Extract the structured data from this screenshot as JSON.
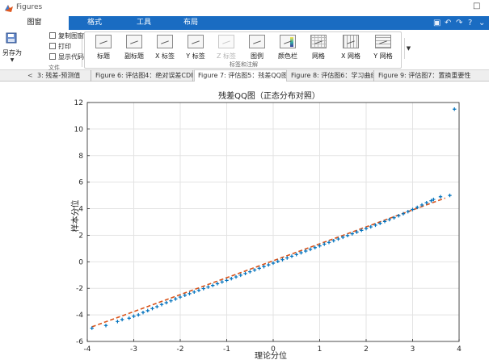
{
  "window": {
    "title": "Figures"
  },
  "ribbon": {
    "tabs": [
      {
        "label": "图窗",
        "active": true
      },
      {
        "label": "格式",
        "active": false
      },
      {
        "label": "工具",
        "active": false
      },
      {
        "label": "布局",
        "active": false
      }
    ]
  },
  "toolstrip": {
    "file_group": {
      "save_as": "另存为",
      "copy_figure": "复制图窗",
      "print": "打印",
      "show_code": "显示代码",
      "label": "文件"
    },
    "annotation_group": {
      "label": "标签和注解",
      "buttons": [
        {
          "label": "标题",
          "enabled": true
        },
        {
          "label": "副标题",
          "enabled": true
        },
        {
          "label": "X 标签",
          "enabled": true
        },
        {
          "label": "Y 标签",
          "enabled": true
        },
        {
          "label": "Z 标签",
          "enabled": false
        },
        {
          "label": "图例",
          "enabled": true
        },
        {
          "label": "颜色栏",
          "enabled": true
        },
        {
          "label": "网格",
          "enabled": true
        },
        {
          "label": "X 网格",
          "enabled": true
        },
        {
          "label": "Y 网格",
          "enabled": true
        }
      ]
    }
  },
  "figure_tabs": {
    "tabs": [
      {
        "label": "3: 残差-预测值",
        "active": false
      },
      {
        "label": "Figure 6: 评估图4：绝对误差CDF",
        "active": false
      },
      {
        "label": "Figure 7: 评估图5：残差QQ图",
        "active": true
      },
      {
        "label": "Figure 8: 评估图6：学习曲线",
        "active": false
      },
      {
        "label": "Figure 9: 评估图7：置换重要性",
        "active": false
      }
    ]
  },
  "chart_data": {
    "type": "scatter",
    "title": "残差QQ图（正态分布对照）",
    "xlabel": "理论分位",
    "ylabel": "样本分位",
    "xlim": [
      -4,
      4
    ],
    "ylim": [
      -6,
      12
    ],
    "xticks": [
      -4,
      -3,
      -2,
      -1,
      0,
      1,
      2,
      3,
      4
    ],
    "yticks": [
      -6,
      -4,
      -2,
      0,
      2,
      4,
      6,
      8,
      10,
      12
    ],
    "grid": true,
    "box": true,
    "series": [
      {
        "kind": "scatter",
        "marker": "+",
        "color": "#0072bd",
        "points": [
          [
            -3.9,
            -5.0
          ],
          [
            -3.6,
            -4.8
          ],
          [
            -3.35,
            -4.5
          ],
          [
            -3.25,
            -4.35
          ],
          [
            -3.1,
            -4.25
          ],
          [
            -3.0,
            -4.1
          ],
          [
            -2.9,
            -4.0
          ],
          [
            -2.8,
            -3.82
          ],
          [
            -2.7,
            -3.68
          ],
          [
            -2.6,
            -3.52
          ],
          [
            -2.5,
            -3.38
          ],
          [
            -2.4,
            -3.22
          ],
          [
            -2.3,
            -3.08
          ],
          [
            -2.2,
            -2.94
          ],
          [
            -2.1,
            -2.8
          ],
          [
            -2.0,
            -2.66
          ],
          [
            -1.9,
            -2.52
          ],
          [
            -1.8,
            -2.4
          ],
          [
            -1.7,
            -2.28
          ],
          [
            -1.6,
            -2.15
          ],
          [
            -1.5,
            -2.02
          ],
          [
            -1.4,
            -1.9
          ],
          [
            -1.3,
            -1.78
          ],
          [
            -1.2,
            -1.65
          ],
          [
            -1.1,
            -1.52
          ],
          [
            -1.0,
            -1.4
          ],
          [
            -0.9,
            -1.27
          ],
          [
            -0.8,
            -1.14
          ],
          [
            -0.7,
            -1.01
          ],
          [
            -0.6,
            -0.88
          ],
          [
            -0.5,
            -0.75
          ],
          [
            -0.4,
            -0.62
          ],
          [
            -0.3,
            -0.49
          ],
          [
            -0.2,
            -0.36
          ],
          [
            -0.1,
            -0.23
          ],
          [
            0.0,
            -0.1
          ],
          [
            0.1,
            0.03
          ],
          [
            0.2,
            0.16
          ],
          [
            0.3,
            0.29
          ],
          [
            0.4,
            0.42
          ],
          [
            0.5,
            0.55
          ],
          [
            0.6,
            0.68
          ],
          [
            0.7,
            0.81
          ],
          [
            0.8,
            0.94
          ],
          [
            0.9,
            1.07
          ],
          [
            1.0,
            1.2
          ],
          [
            1.1,
            1.33
          ],
          [
            1.2,
            1.46
          ],
          [
            1.3,
            1.59
          ],
          [
            1.4,
            1.72
          ],
          [
            1.5,
            1.85
          ],
          [
            1.6,
            1.98
          ],
          [
            1.7,
            2.11
          ],
          [
            1.8,
            2.24
          ],
          [
            1.9,
            2.37
          ],
          [
            2.0,
            2.5
          ],
          [
            2.1,
            2.63
          ],
          [
            2.2,
            2.76
          ],
          [
            2.3,
            2.9
          ],
          [
            2.4,
            3.04
          ],
          [
            2.5,
            3.18
          ],
          [
            2.6,
            3.32
          ],
          [
            2.7,
            3.47
          ],
          [
            2.8,
            3.62
          ],
          [
            2.9,
            3.78
          ],
          [
            3.0,
            3.94
          ],
          [
            3.1,
            4.1
          ],
          [
            3.2,
            4.28
          ],
          [
            3.3,
            4.45
          ],
          [
            3.4,
            4.6
          ],
          [
            3.45,
            4.7
          ],
          [
            3.6,
            4.9
          ],
          [
            3.8,
            5.0
          ],
          [
            3.9,
            11.5
          ]
        ]
      },
      {
        "kind": "line",
        "style": "dashed",
        "color": "#d95319",
        "points": [
          [
            -3.9,
            -4.9
          ],
          [
            3.7,
            4.8
          ]
        ]
      }
    ]
  }
}
